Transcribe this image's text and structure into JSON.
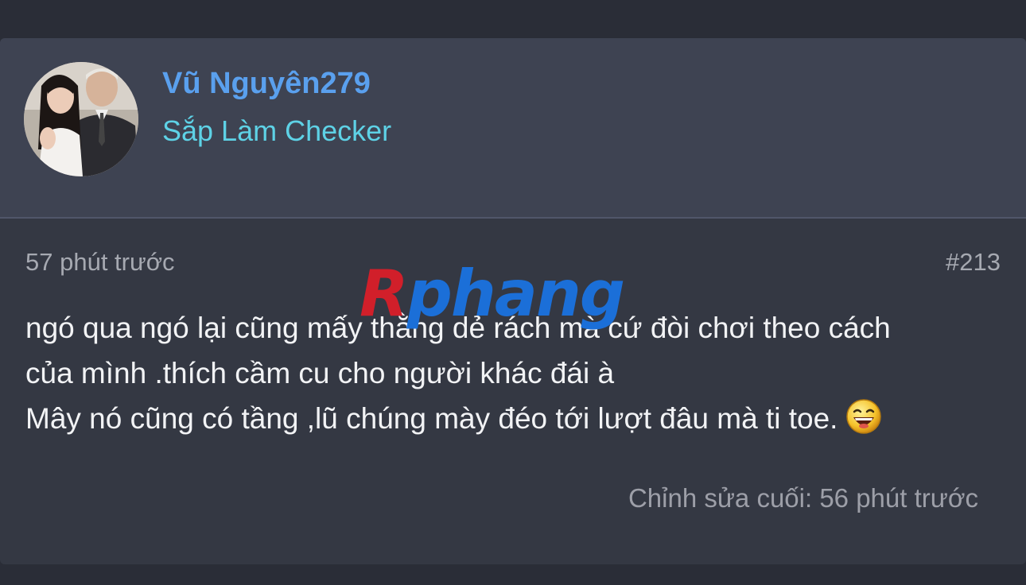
{
  "author": {
    "name": "Vũ Nguyên279",
    "title": "Sắp Làm Checker",
    "avatar_icon": "avatar-photo"
  },
  "post": {
    "time": "57 phút trước",
    "number": "#213",
    "lines": [
      "ngó qua ngó lại cũng mấy thằng dẻ rách mà cứ đòi chơi theo cách",
      "của mình .thích cầm cu cho người khác đái à",
      "Mây nó cũng có tầng ,lũ chúng mày đéo tới lượt đâu mà ti toe."
    ],
    "emoji_icon": "laughing-emoji",
    "edited": "Chỉnh sửa cuối: 56 phút trước"
  },
  "watermark": {
    "text": "Rphang"
  },
  "colors": {
    "background": "#2a2d37",
    "card": "#343843",
    "header": "#3e4352",
    "author_name": "#5aa0ee",
    "author_title": "#5ed2e6",
    "muted_text": "#a6a9b1",
    "body_text": "#f2f3f5"
  }
}
